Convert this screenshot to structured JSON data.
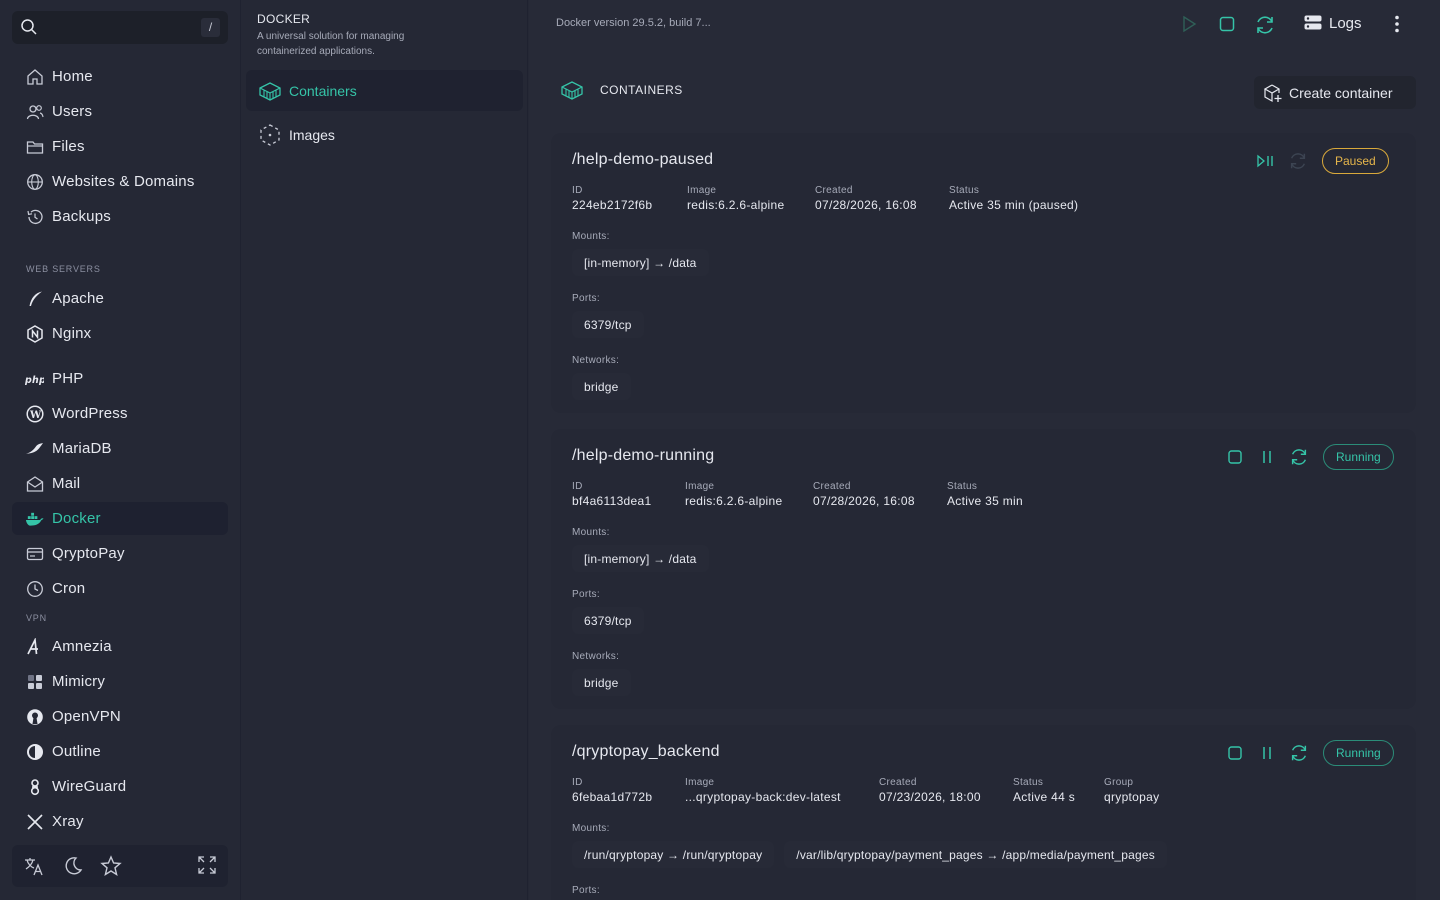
{
  "sidebar": {
    "search_shortcut": "/",
    "items": [
      {
        "label": "Home",
        "icon": "home-icon"
      },
      {
        "label": "Users",
        "icon": "users-icon"
      },
      {
        "label": "Files",
        "icon": "folder-icon"
      },
      {
        "label": "Websites & Domains",
        "icon": "globe-icon"
      },
      {
        "label": "Backups",
        "icon": "history-icon"
      },
      {
        "label": "Apache",
        "icon": "feather-icon"
      },
      {
        "label": "Nginx",
        "icon": "nginx-icon"
      },
      {
        "label": "PHP",
        "icon": "php-icon"
      },
      {
        "label": "WordPress",
        "icon": "wordpress-icon"
      },
      {
        "label": "MariaDB",
        "icon": "mariadb-icon"
      },
      {
        "label": "Mail",
        "icon": "mail-icon"
      },
      {
        "label": "Docker",
        "icon": "docker-icon"
      },
      {
        "label": "QryptoPay",
        "icon": "card-icon"
      },
      {
        "label": "Cron",
        "icon": "clock-icon"
      },
      {
        "label": "Amnezia",
        "icon": "amnezia-icon"
      },
      {
        "label": "Mimicry",
        "icon": "mimicry-icon"
      },
      {
        "label": "OpenVPN",
        "icon": "openvpn-icon"
      },
      {
        "label": "Outline",
        "icon": "outline-icon"
      },
      {
        "label": "WireGuard",
        "icon": "wireguard-icon"
      },
      {
        "label": "Xray",
        "icon": "xray-icon"
      }
    ],
    "sections": {
      "web_servers": "WEB SERVERS",
      "vpn": "VPN"
    }
  },
  "panel": {
    "title": "DOCKER",
    "description": "A universal solution for managing containerized applications.",
    "items": [
      {
        "label": "Containers"
      },
      {
        "label": "Images"
      }
    ]
  },
  "topbar": {
    "version": "Docker version 29.5.2, build 7...",
    "logs_label": "Logs"
  },
  "main": {
    "heading": "CONTAINERS",
    "create_label": "Create container",
    "labels": {
      "id": "ID",
      "image": "Image",
      "created": "Created",
      "status": "Status",
      "group": "Group",
      "mounts": "Mounts:",
      "ports": "Ports:",
      "networks": "Networks:"
    },
    "containers": [
      {
        "name": "/help-demo-paused",
        "state": "Paused",
        "id": "224eb2172f6b",
        "image": "redis:6.2.6-alpine",
        "created": "07/28/2026, 16:08",
        "status": "Active 35 min (paused)",
        "mounts": [
          "[in-memory] → /data"
        ],
        "ports": [
          "6379/tcp"
        ],
        "networks": [
          "bridge"
        ]
      },
      {
        "name": "/help-demo-running",
        "state": "Running",
        "id": "bf4a6113dea1",
        "image": "redis:6.2.6-alpine",
        "created": "07/28/2026, 16:08",
        "status": "Active 35 min",
        "mounts": [
          "[in-memory] → /data"
        ],
        "ports": [
          "6379/tcp"
        ],
        "networks": [
          "bridge"
        ]
      },
      {
        "name": "/qryptopay_backend",
        "state": "Running",
        "id": "6febaa1d772b",
        "image": "...qryptopay-back:dev-latest",
        "created": "07/23/2026, 18:00",
        "status": "Active 44 s",
        "group": "qryptopay",
        "mounts": [
          "/run/qryptopay → /run/qryptopay",
          "/var/lib/qryptopay/payment_pages → /app/media/payment_pages"
        ]
      }
    ]
  },
  "colors": {
    "accent": "#35c4a8",
    "paused": "#e6b64b",
    "bg": "#252835"
  }
}
